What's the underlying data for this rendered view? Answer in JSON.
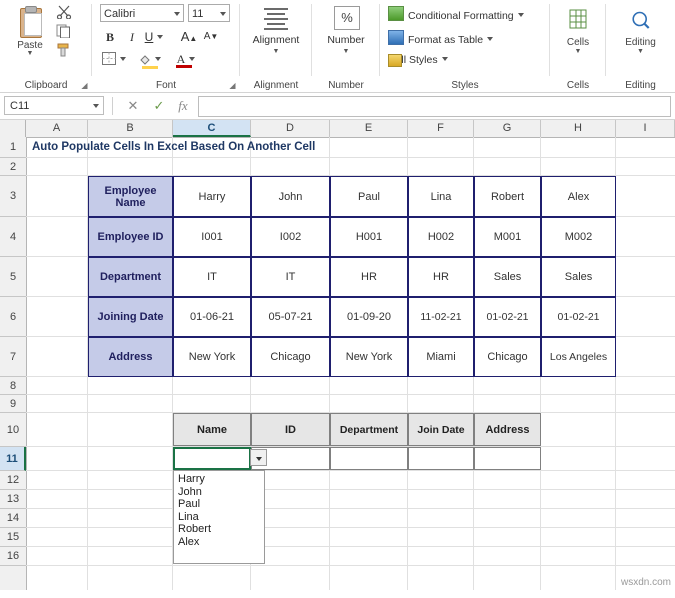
{
  "ribbon": {
    "clipboard": {
      "group_label": "Clipboard",
      "paste_label": "Paste",
      "cut_label": "Cut",
      "copy_label": "Copy",
      "format_painter_label": "Format Painter"
    },
    "font": {
      "group_label": "Font",
      "font_name": "Calibri",
      "font_size": "11",
      "bold": "B",
      "italic": "I",
      "underline": "U",
      "grow_font": "A",
      "shrink_font": "A",
      "borders": "⬚",
      "fill_color": "A",
      "font_color": "A"
    },
    "alignment": {
      "group_label": "Alignment",
      "button_label": "Alignment"
    },
    "number": {
      "group_label": "Number",
      "button_label": "Number",
      "icon": "%"
    },
    "styles": {
      "group_label": "Styles",
      "conditional_formatting": "Conditional Formatting",
      "format_as_table": "Format as Table",
      "cell_styles": "Cell Styles"
    },
    "cells": {
      "group_label": "Cells",
      "button_label": "Cells"
    },
    "editing": {
      "group_label": "Editing",
      "button_label": "Editing"
    }
  },
  "formula_bar": {
    "name_box": "C11",
    "cancel_icon": "✕",
    "enter_icon": "✓",
    "function_icon": "fx",
    "formula_value": ""
  },
  "grid": {
    "columns": [
      "A",
      "B",
      "C",
      "D",
      "E",
      "F",
      "G",
      "H",
      "I"
    ],
    "selected_column": "C",
    "rows": [
      "1",
      "2",
      "3",
      "4",
      "5",
      "6",
      "7",
      "8",
      "9",
      "10",
      "11",
      "12",
      "13",
      "14",
      "15",
      "16"
    ],
    "selected_row": "11",
    "title": "Auto Populate Cells In Excel Based On Another Cell"
  },
  "table1": {
    "row_labels": [
      "Employee Name",
      "Employee ID",
      "Department",
      "Joining Date",
      "Address"
    ],
    "columns": [
      {
        "name": "Harry",
        "id": "I001",
        "department": "IT",
        "joining_date": "01-06-21",
        "address": "New York"
      },
      {
        "name": "John",
        "id": "I002",
        "department": "IT",
        "joining_date": "05-07-21",
        "address": "Chicago"
      },
      {
        "name": "Paul",
        "id": "H001",
        "department": "HR",
        "joining_date": "01-09-20",
        "address": "New York"
      },
      {
        "name": "Lina",
        "id": "H002",
        "department": "HR",
        "joining_date": "11-02-21",
        "address": "Miami"
      },
      {
        "name": "Robert",
        "id": "M001",
        "department": "Sales",
        "joining_date": "01-02-21",
        "address": "Chicago"
      },
      {
        "name": "Alex",
        "id": "M002",
        "department": "Sales",
        "joining_date": "01-02-21",
        "address": "Los Angeles"
      }
    ]
  },
  "table2": {
    "headers": [
      "Name",
      "ID",
      "Department",
      "Join Date",
      "Address"
    ],
    "values": [
      "",
      "",
      "",
      "",
      ""
    ]
  },
  "dropdown": {
    "open": true,
    "items": [
      "Harry",
      "John",
      "Paul",
      "Lina",
      "Robert",
      "Alex"
    ]
  },
  "watermark": "wsxdn.com"
}
